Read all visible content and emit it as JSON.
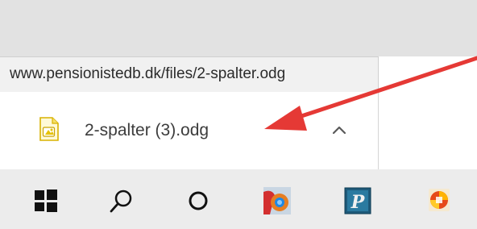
{
  "address_bar": {
    "url": "www.pensionistedb.dk/files/2-spalter.odg"
  },
  "download": {
    "file_name": "2-spalter (3).odg",
    "file_icon": "libreoffice-draw-file-icon",
    "chevron_icon": "chevron-up-icon"
  },
  "taskbar": {
    "icons": [
      "windows-start-icon",
      "search-icon",
      "task-view-icon",
      "app-icon-red",
      "app-icon-publisher",
      "app-icon-colorful"
    ]
  },
  "annotation": {
    "arrow_color": "#e53935"
  }
}
